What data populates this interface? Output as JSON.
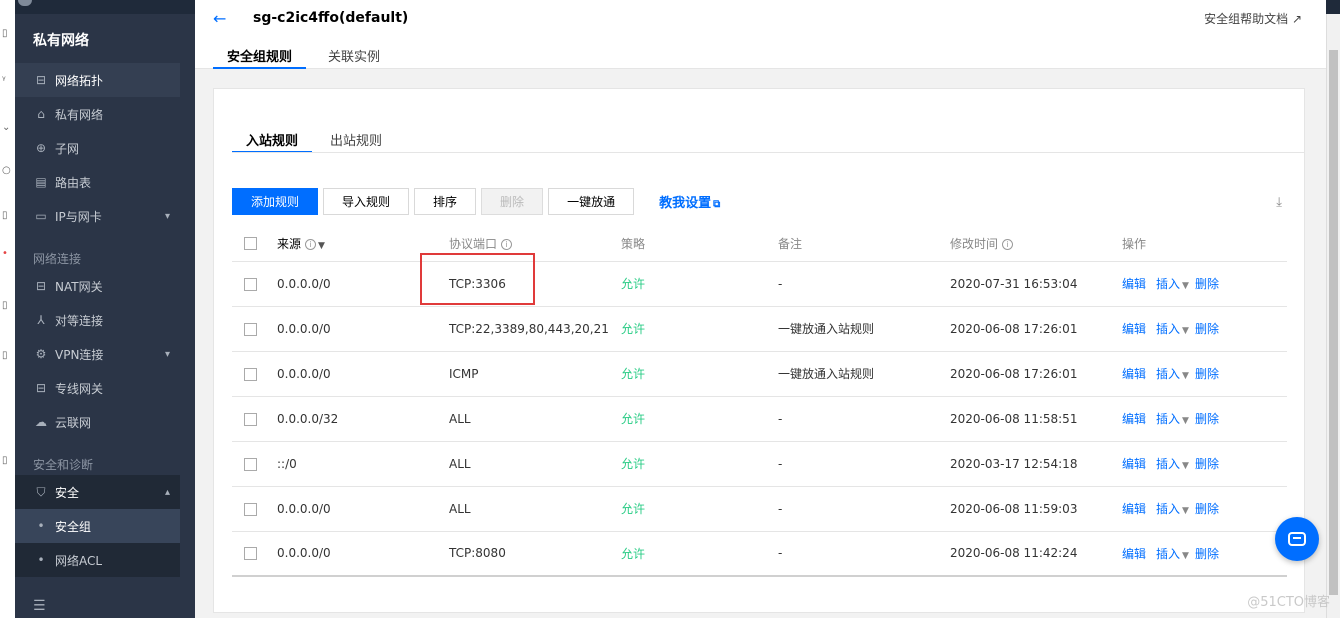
{
  "left_strip": {
    "glyphs": [
      "▯",
      "ᵞ",
      "⌄",
      "○",
      "▯",
      "•",
      "▯",
      "▯",
      "▯"
    ]
  },
  "header": {
    "back_icon": "arrow-left-icon",
    "title": "sg-c2ic4ffo(default)",
    "help_link": "安全组帮助文档 ↗",
    "tabs": [
      {
        "label": "安全组规则",
        "active": true
      },
      {
        "label": "关联实例",
        "active": false
      }
    ]
  },
  "sidebar": {
    "title": "私有网络",
    "items": [
      {
        "label": "网络拓扑",
        "icon": "topology-icon"
      },
      {
        "label": "私有网络",
        "icon": "vpc-icon"
      },
      {
        "label": "子网",
        "icon": "globe-icon"
      },
      {
        "label": "路由表",
        "icon": "route-table-icon"
      },
      {
        "label": "IP与网卡",
        "icon": "nic-icon",
        "chevron": "▾"
      }
    ],
    "group_network_connect": "网络连接",
    "items2": [
      {
        "label": "NAT网关",
        "icon": "nat-icon"
      },
      {
        "label": "对等连接",
        "icon": "peering-icon"
      },
      {
        "label": "VPN连接",
        "icon": "vpn-icon",
        "chevron": "▾"
      },
      {
        "label": "专线网关",
        "icon": "dc-gateway-icon"
      },
      {
        "label": "云联网",
        "icon": "ccn-icon"
      }
    ],
    "group_security": "安全和诊断",
    "security": {
      "label": "安全",
      "icon": "shield-icon",
      "chevron": "▴"
    },
    "sub_items": [
      {
        "label": "安全组",
        "current": true
      },
      {
        "label": "网络ACL",
        "current": false
      }
    ],
    "collapse_icon": "collapse-menu-icon"
  },
  "rules": {
    "subtabs": [
      {
        "label": "入站规则",
        "active": true
      },
      {
        "label": "出站规则",
        "active": false
      }
    ],
    "toolbar": {
      "add": "添加规则",
      "import": "导入规则",
      "sort": "排序",
      "delete": "删除",
      "allow_all": "一键放通",
      "teach": "教我设置",
      "download_icon": "download-icon"
    },
    "columns": {
      "source": "来源",
      "protocol": "协议端口",
      "policy": "策略",
      "note": "备注",
      "modified": "修改时间",
      "actions": "操作"
    },
    "rows": [
      {
        "source": "0.0.0.0/0",
        "protocol": "TCP:3306",
        "policy": "允许",
        "note": "-",
        "modified": "2020-07-31 16:53:04"
      },
      {
        "source": "0.0.0.0/0",
        "protocol": "TCP:22,3389,80,443,20,21",
        "policy": "允许",
        "note": "一键放通入站规则",
        "modified": "2020-06-08 17:26:01"
      },
      {
        "source": "0.0.0.0/0",
        "protocol": "ICMP",
        "policy": "允许",
        "note": "一键放通入站规则",
        "modified": "2020-06-08 17:26:01"
      },
      {
        "source": "0.0.0.0/32",
        "protocol": "ALL",
        "policy": "允许",
        "note": "-",
        "modified": "2020-06-08 11:58:51"
      },
      {
        "source": "::/0",
        "protocol": "ALL",
        "policy": "允许",
        "note": "-",
        "modified": "2020-03-17 12:54:18"
      },
      {
        "source": "0.0.0.0/0",
        "protocol": "ALL",
        "policy": "允许",
        "note": "-",
        "modified": "2020-06-08 11:59:03"
      },
      {
        "source": "0.0.0.0/0",
        "protocol": "TCP:8080",
        "policy": "允许",
        "note": "-",
        "modified": "2020-06-08 11:42:24"
      }
    ],
    "row_actions": {
      "edit": "编辑",
      "insert": "插入",
      "delete": "删除"
    }
  },
  "watermark": "@51CTO博客",
  "colors": {
    "primary": "#006eff",
    "allow": "#29cc85",
    "sidebar": "#2b3547",
    "highlight": "#e03a3a"
  }
}
